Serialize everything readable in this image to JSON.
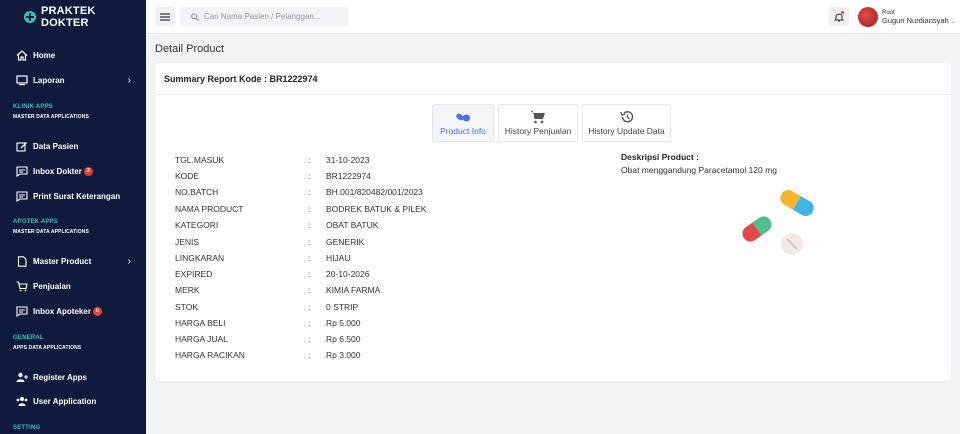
{
  "brand": "PRAKTEK DOKTER",
  "sidebar": {
    "items": [
      {
        "label": "Home"
      },
      {
        "label": "Laporan"
      },
      {
        "label": "Data Pasien"
      },
      {
        "label": "Inbox Dokter",
        "badge": "2"
      },
      {
        "label": "Print Surat Keterangan"
      },
      {
        "label": "Master Product"
      },
      {
        "label": "Penjualan"
      },
      {
        "label": "Inbox Apoteker",
        "badge": "0"
      },
      {
        "label": "Register Apps"
      },
      {
        "label": "User Application"
      }
    ],
    "sections": [
      {
        "title": "KLINIK APPS",
        "subtitle": "MASTER DATA APPLICATIONS"
      },
      {
        "title": "APOTEK APPS",
        "subtitle": "MASTER DATA APPLICATIONS"
      },
      {
        "title": "GENERAL",
        "subtitle": "APPS DATA APPLICATIONS"
      },
      {
        "title": "SETTING"
      }
    ]
  },
  "topbar": {
    "search_placeholder": "Cari Nama Pasien / Pelanggan...",
    "user_role": "Root",
    "user_name": "Gugun Nurdiansyah"
  },
  "page_title": "Detail Product",
  "card_title": "Summary Report Kode : BR1222974",
  "tabs": [
    {
      "label": "Product Info",
      "icon": "pills-icon",
      "active": true
    },
    {
      "label": "History Penjualan",
      "icon": "cart-icon",
      "active": false
    },
    {
      "label": "History Update Data",
      "icon": "history-icon",
      "active": false
    }
  ],
  "details": [
    {
      "label": "TGL.MASUK",
      "value": "31-10-2023"
    },
    {
      "label": "KODE",
      "value": "BR1222974"
    },
    {
      "label": "NO.BATCH",
      "value": "BH.001/820482/001/2023"
    },
    {
      "label": "NAMA PRODUCT",
      "value": "BODREK BATUK & PILEK"
    },
    {
      "label": "KATEGORI",
      "value": "OBAT BATUK"
    },
    {
      "label": "JENIS",
      "value": "GENERIK"
    },
    {
      "label": "LINGKARAN",
      "value": "HIJAU"
    },
    {
      "label": "EXPIRED",
      "value": "20-10-2026"
    },
    {
      "label": "MERK",
      "value": "KIMIA FARMA"
    },
    {
      "label": "STOK",
      "value": "0 STRIP"
    },
    {
      "label": "HARGA BELI",
      "value": "Rp 5.000"
    },
    {
      "label": "HARGA JUAL",
      "value": "Rp 6.500"
    },
    {
      "label": "HARGA RACIKAN",
      "value": "Rp 3.000"
    }
  ],
  "detail_colon": ":",
  "description": {
    "title": "Deskripsi Product :",
    "text": "Obat menggandung Paracetamol 120 mg"
  },
  "colors": {
    "sidebar_bg": "#0f1a3d",
    "accent": "#2ec4b6",
    "active_tab": "#4a6cf7",
    "badge": "#e8423b"
  }
}
